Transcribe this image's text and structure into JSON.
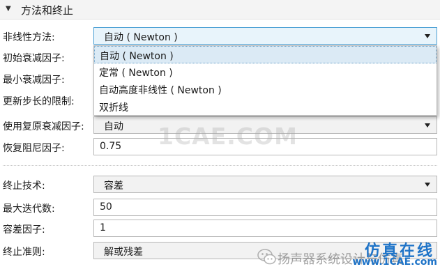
{
  "section": {
    "title": "方法和终止"
  },
  "rows": {
    "nonlinear_method": {
      "label": "非线性方法:",
      "value": "自动 ( Newton )"
    },
    "initial_damping": {
      "label": "初始衰减因子:"
    },
    "min_damping": {
      "label": "最小衰减因子:"
    },
    "step_limit": {
      "label": "更新步长的限制:"
    },
    "use_recovery": {
      "label": "使用复原衰减因子:",
      "value": "自动"
    },
    "recovery_damping": {
      "label": "恢复阻尼因子:",
      "value": "0.75"
    },
    "termination_technique": {
      "label": "终止技术:",
      "value": "容差"
    },
    "max_iterations": {
      "label": "最大迭代数:",
      "value": "50"
    },
    "tolerance_factor": {
      "label": "容差因子:",
      "value": "1"
    },
    "termination_criterion": {
      "label": "终止准则:",
      "value": "解或残差"
    }
  },
  "dropdown": {
    "options": [
      "自动 ( Newton )",
      "定常 ( Newton )",
      "自动高度非线性 ( Newton )",
      "双折线"
    ],
    "selected_index": 0
  },
  "watermark": {
    "text": "1CAE.COM"
  },
  "footer": {
    "brand_text": "扬声器系统设计与仿真",
    "logo_text": "仿真在线",
    "logo_site": "www.1CAE.com"
  },
  "icons": {
    "section_toggle": "caret-down-icon",
    "select_arrow": "chevron-down-icon",
    "wechat": "wechat-icon"
  },
  "colors": {
    "focus_border": "#4a9fd4",
    "focus_fill": "#e8f4fb",
    "selected_option": "#dbeaf5",
    "logo_blue": "#1f74c8"
  }
}
